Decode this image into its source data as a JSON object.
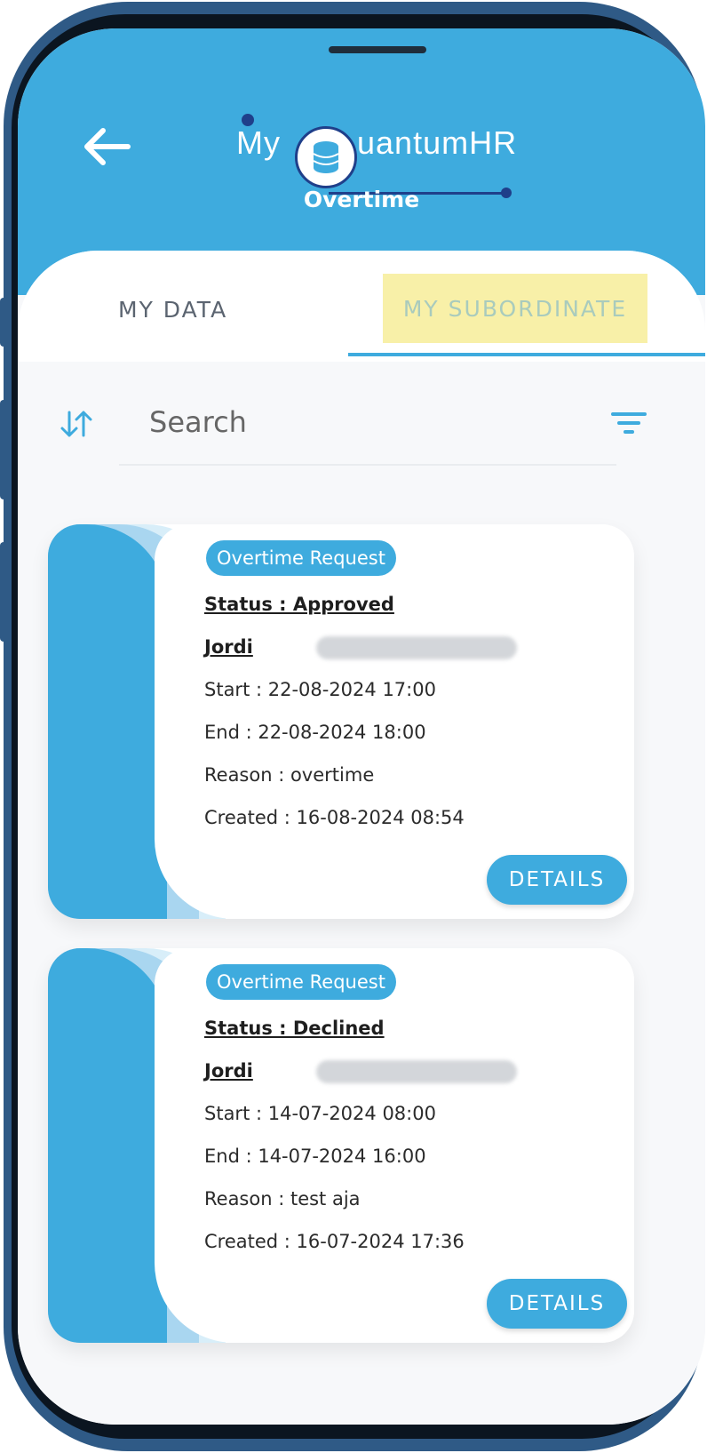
{
  "app": {
    "logo_prefix": "My",
    "logo_suffix": "uantumHR",
    "page_title": "Overtime"
  },
  "colors": {
    "primary": "#3eabde",
    "highlight": "#f8f0a8",
    "frame": "#2f5a86"
  },
  "tabs": [
    {
      "label": "MY DATA",
      "active": false
    },
    {
      "label": "MY SUBORDINATE",
      "active": true
    }
  ],
  "search": {
    "placeholder": "Search"
  },
  "icons": {
    "back": "arrow-left-icon",
    "sort": "sort-arrows-icon",
    "filter": "filter-lines-icon",
    "logo": "database-icon"
  },
  "requests": [
    {
      "type": "Overtime Request",
      "status": "Status : Approved",
      "name": "Jordi",
      "start": "Start : 22-08-2024 17:00",
      "end": "End : 22-08-2024 18:00",
      "reason": "Reason : overtime",
      "created": "Created : 16-08-2024 08:54",
      "action": "DETAILS"
    },
    {
      "type": "Overtime Request",
      "status": "Status : Declined",
      "name": "Jordi",
      "start": "Start : 14-07-2024 08:00",
      "end": "End : 14-07-2024 16:00",
      "reason": "Reason : test aja",
      "created": "Created : 16-07-2024 17:36",
      "action": "DETAILS"
    }
  ]
}
